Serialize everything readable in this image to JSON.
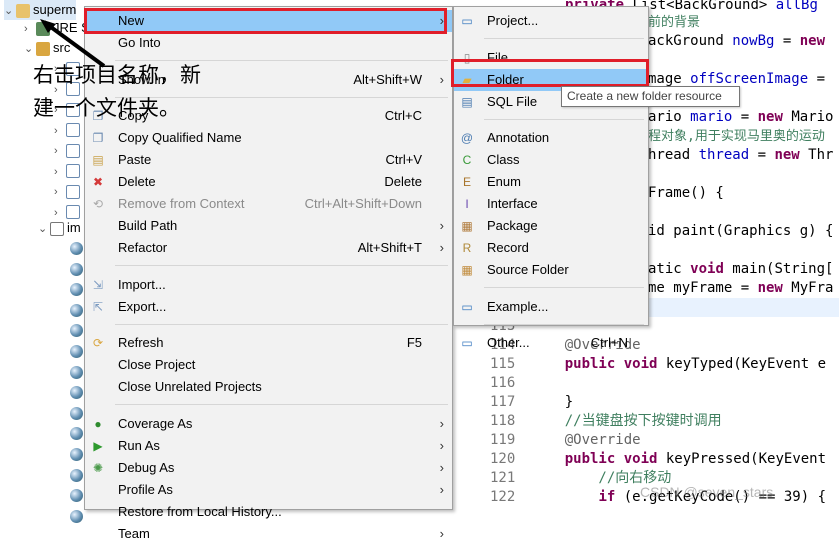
{
  "tree": {
    "project": "superm",
    "items": [
      "JRE S",
      "src",
      "im"
    ]
  },
  "editor": {
    "top_lines": [
      {
        "text": "private List<BackGround> allBg",
        "kind": "decl"
      },
      {
        "text": "前的背景",
        "kind": "comment"
      },
      {
        "text": "ackGround nowBg = new",
        "kind": "decl"
      },
      {
        "text": "mage offScreenImage =",
        "kind": "decl"
      },
      {
        "text": "ario mario = new Mario",
        "kind": "decl"
      },
      {
        "text": "程对象,用于实现马里奥的运动",
        "kind": "comment"
      },
      {
        "text": "hread thread = new Thr",
        "kind": "decl"
      },
      {
        "text": "Frame() {",
        "kind": "plain"
      },
      {
        "text": "id paint(Graphics g) {",
        "kind": "plain"
      },
      {
        "text": "atic void main(String[",
        "kind": "plain"
      },
      {
        "text": "me myFrame = new MyFra",
        "kind": "plain"
      }
    ],
    "lines": [
      {
        "num": "113",
        "text": ""
      },
      {
        "num": "114",
        "text": "    @Override"
      },
      {
        "num": "115",
        "text": "    public void keyTyped(KeyEvent e"
      },
      {
        "num": "116",
        "text": ""
      },
      {
        "num": "117",
        "text": "    }"
      },
      {
        "num": "118",
        "text": "    //当键盘按下按键时调用"
      },
      {
        "num": "119",
        "text": "    @Override"
      },
      {
        "num": "120",
        "text": "    public void keyPressed(KeyEvent"
      },
      {
        "num": "121",
        "text": "        //向右移动"
      },
      {
        "num": "122",
        "text": "        if (e.getKeyCode() == 39) {"
      }
    ]
  },
  "context_menu": {
    "items": [
      {
        "label": "New",
        "shortcut": "",
        "submenu": true,
        "highlighted": true
      },
      {
        "label": "Go Into",
        "shortcut": ""
      },
      {
        "sep": true
      },
      {
        "label": "Show In",
        "shortcut": "Alt+Shift+W",
        "submenu": true
      },
      {
        "sep": true
      },
      {
        "label": "Copy",
        "shortcut": "Ctrl+C",
        "icon": "copy-icon"
      },
      {
        "label": "Copy Qualified Name",
        "shortcut": "",
        "icon": "copy-qualified-icon"
      },
      {
        "label": "Paste",
        "shortcut": "Ctrl+V",
        "icon": "paste-icon"
      },
      {
        "label": "Delete",
        "shortcut": "Delete",
        "icon": "delete-icon"
      },
      {
        "label": "Remove from Context",
        "shortcut": "Ctrl+Alt+Shift+Down",
        "disabled": true,
        "icon": "remove-context-icon"
      },
      {
        "label": "Build Path",
        "shortcut": "",
        "submenu": true
      },
      {
        "label": "Refactor",
        "shortcut": "Alt+Shift+T",
        "submenu": true
      },
      {
        "sep": true
      },
      {
        "label": "Import...",
        "shortcut": "",
        "icon": "import-icon"
      },
      {
        "label": "Export...",
        "shortcut": "",
        "icon": "export-icon"
      },
      {
        "sep": true
      },
      {
        "label": "Refresh",
        "shortcut": "F5",
        "icon": "refresh-icon"
      },
      {
        "label": "Close Project",
        "shortcut": ""
      },
      {
        "label": "Close Unrelated Projects",
        "shortcut": ""
      },
      {
        "sep": true
      },
      {
        "label": "Coverage As",
        "shortcut": "",
        "submenu": true,
        "icon": "coverage-icon"
      },
      {
        "label": "Run As",
        "shortcut": "",
        "submenu": true,
        "icon": "run-icon"
      },
      {
        "label": "Debug As",
        "shortcut": "",
        "submenu": true,
        "icon": "debug-icon"
      },
      {
        "label": "Profile As",
        "shortcut": "",
        "submenu": true
      },
      {
        "label": "Restore from Local History...",
        "shortcut": ""
      },
      {
        "label": "Team",
        "shortcut": "",
        "submenu": true
      }
    ]
  },
  "new_submenu": {
    "items": [
      {
        "label": "Project...",
        "icon": "new-project-icon"
      },
      {
        "sep": true
      },
      {
        "label": "File",
        "icon": "new-file-icon"
      },
      {
        "label": "Folder",
        "icon": "new-folder-icon",
        "highlighted": true
      },
      {
        "label": "SQL File",
        "icon": "sql-file-icon"
      },
      {
        "sep": true
      },
      {
        "label": "Annotation",
        "icon": "annotation-icon"
      },
      {
        "label": "Class",
        "icon": "class-icon"
      },
      {
        "label": "Enum",
        "icon": "enum-icon"
      },
      {
        "label": "Interface",
        "icon": "interface-icon"
      },
      {
        "label": "Package",
        "icon": "package-icon"
      },
      {
        "label": "Record",
        "icon": "record-icon"
      },
      {
        "label": "Source Folder",
        "icon": "source-folder-icon"
      },
      {
        "sep": true
      },
      {
        "label": "Example...",
        "icon": "example-icon"
      },
      {
        "sep": true
      },
      {
        "label": "Other...",
        "shortcut": "Ctrl+N",
        "icon": "other-icon"
      }
    ]
  },
  "tooltip": "Create a new folder resource",
  "annotation": {
    "line1": "右击项目名称，新",
    "line2": "建一个文件夹。"
  },
  "watermark": "CSDN @seven_stars",
  "colors": {
    "highlight": "#91c9f7",
    "annotation_box": "#e01e2a",
    "keyword": "#7f0055",
    "comment": "#3f7f5f"
  }
}
